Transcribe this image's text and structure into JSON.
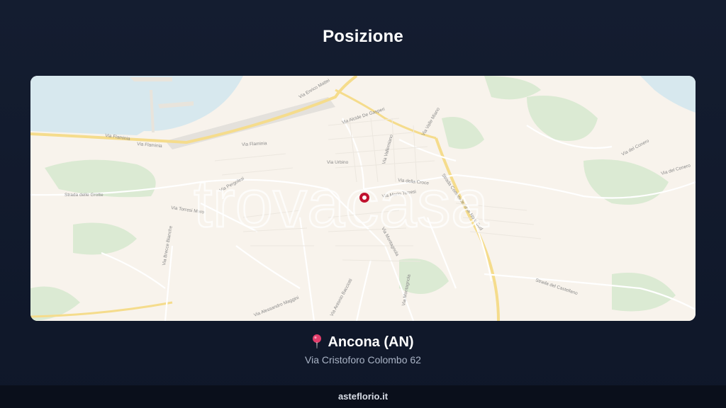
{
  "section": {
    "title": "Posizione"
  },
  "map": {
    "watermark": "trovacasa",
    "streets": [
      "Via Flaminia",
      "Via Flaminia",
      "Via Flaminia",
      "Via Alcide De Gasperi",
      "Via Urbino",
      "Via della Croce",
      "Via Mario Torresi",
      "Via Montagnola",
      "Via Vallemiano",
      "Strada delle Grotte",
      "Via Torresi Moro",
      "Via Alessandro Maggini",
      "Via Antonio Bacciotti",
      "Via del Conero",
      "Via del Conero",
      "Strada del Castellano",
      "Via Enrico Mattei",
      "Via Pergolesi",
      "Via Montagnola",
      "Via Brecce Bianche",
      "Via Valle Miano",
      "Strada Comunale Asse Nord Sud"
    ]
  },
  "location": {
    "pin_icon": "map-pin-icon",
    "city": "Ancona (AN)",
    "address": "Via Cristoforo Colombo 62"
  },
  "footer": {
    "site": "asteflorio.it"
  }
}
